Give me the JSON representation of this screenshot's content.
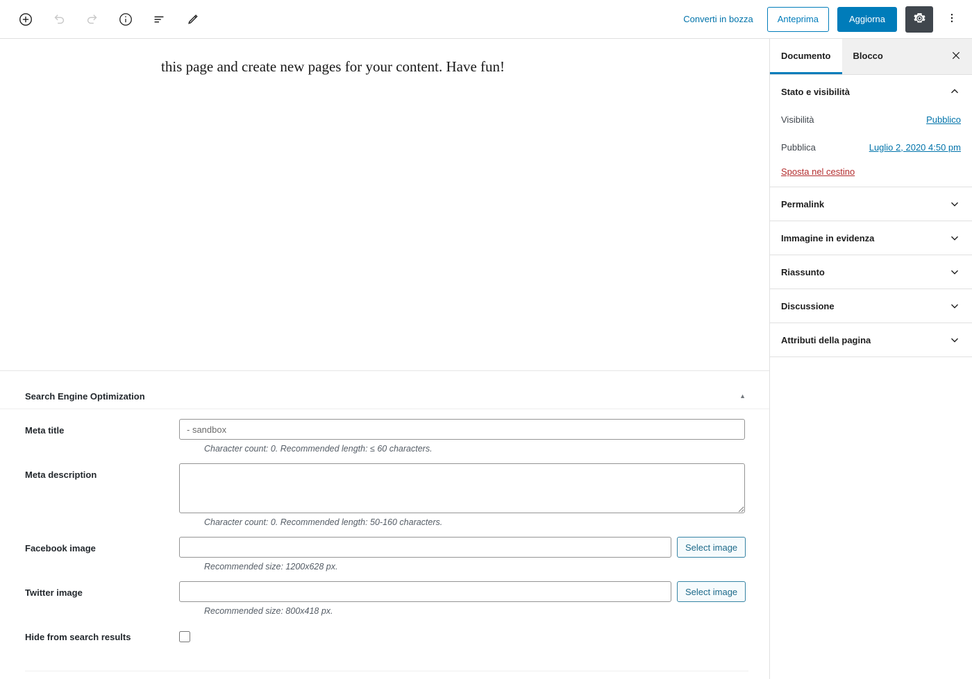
{
  "toolbar": {
    "left_tools": [
      {
        "name": "add-block-icon",
        "label": "Aggiungi blocco"
      },
      {
        "name": "undo-icon",
        "label": "Annulla"
      },
      {
        "name": "redo-icon",
        "label": "Ripeti"
      },
      {
        "name": "info-icon",
        "label": "Informazioni sul contenuto"
      },
      {
        "name": "list-view-icon",
        "label": "Vista elenco blocchi"
      },
      {
        "name": "pencil-icon",
        "label": "Modifica"
      }
    ],
    "switch_to_draft": "Converti in bozza",
    "preview": "Anteprima",
    "update": "Aggiorna",
    "settings_icon": "gear-icon",
    "more_menu_icon": "ellipsis-vertical-icon"
  },
  "editor": {
    "paragraph": "this page and create new pages for your content. Have fun!"
  },
  "metabox": {
    "title": "Search Engine Optimization",
    "toggle_glyph": "▲",
    "fields": {
      "meta_title": {
        "label": "Meta title",
        "value": "",
        "placeholder": "- sandbox",
        "help": "Character count: 0. Recommended length: ≤ 60 characters."
      },
      "meta_description": {
        "label": "Meta description",
        "value": "",
        "placeholder": "",
        "help": "Character count: 0. Recommended length: 50-160 characters."
      },
      "facebook_image": {
        "label": "Facebook image",
        "value": "",
        "placeholder": "",
        "button": "Select image",
        "help": "Recommended size: 1200x628 px."
      },
      "twitter_image": {
        "label": "Twitter image",
        "value": "",
        "placeholder": "",
        "button": "Select image",
        "help": "Recommended size: 800x418 px."
      },
      "hide_from_search": {
        "label": "Hide from search results",
        "checked": false
      }
    }
  },
  "sidebar": {
    "tabs": [
      {
        "label": "Documento",
        "active": true
      },
      {
        "label": "Blocco",
        "active": false
      }
    ],
    "close_icon": "close-icon",
    "status_panel": {
      "title": "Stato e visibilità",
      "expanded": true,
      "visibility_label": "Visibilità",
      "visibility_value": "Pubblico",
      "publish_label": "Pubblica",
      "publish_value": "Luglio 2, 2020 4:50 pm",
      "trash_label": "Sposta nel cestino"
    },
    "panels": [
      {
        "label": "Permalink"
      },
      {
        "label": "Immagine in evidenza"
      },
      {
        "label": "Riassunto"
      },
      {
        "label": "Discussione"
      },
      {
        "label": "Attributi della pagina"
      }
    ]
  },
  "colors": {
    "accent": "#007cba",
    "link": "#0073aa",
    "danger": "#b32d2e",
    "gear_bg": "#40464d",
    "border": "#e0e0e0"
  }
}
